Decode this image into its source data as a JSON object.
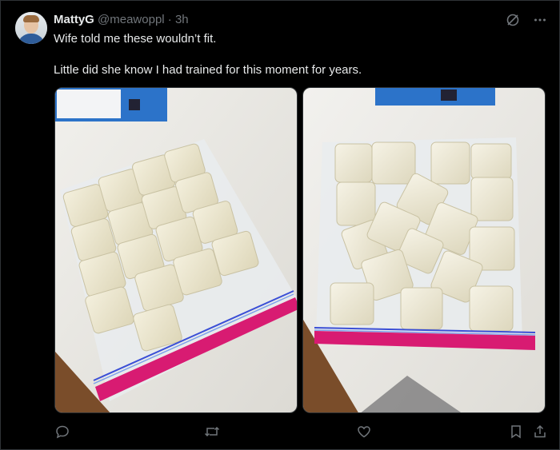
{
  "tweet": {
    "author_name": "MattyG",
    "author_handle": "@meawoppl",
    "separator": "·",
    "time": "3h",
    "text_line1": "Wife told me these wouldn’t fit.",
    "text_line2": "Little did she know I had trained for this moment for years."
  },
  "icons": {
    "grok": "grok-icon",
    "more": "more-icon",
    "reply": "reply-icon",
    "retweet": "retweet-icon",
    "like": "heart-icon",
    "bookmark": "bookmark-icon",
    "share": "share-icon"
  },
  "colors": {
    "background": "#000000",
    "text_primary": "#e7e9ea",
    "text_secondary": "#71767b",
    "border": "#2f3336"
  }
}
